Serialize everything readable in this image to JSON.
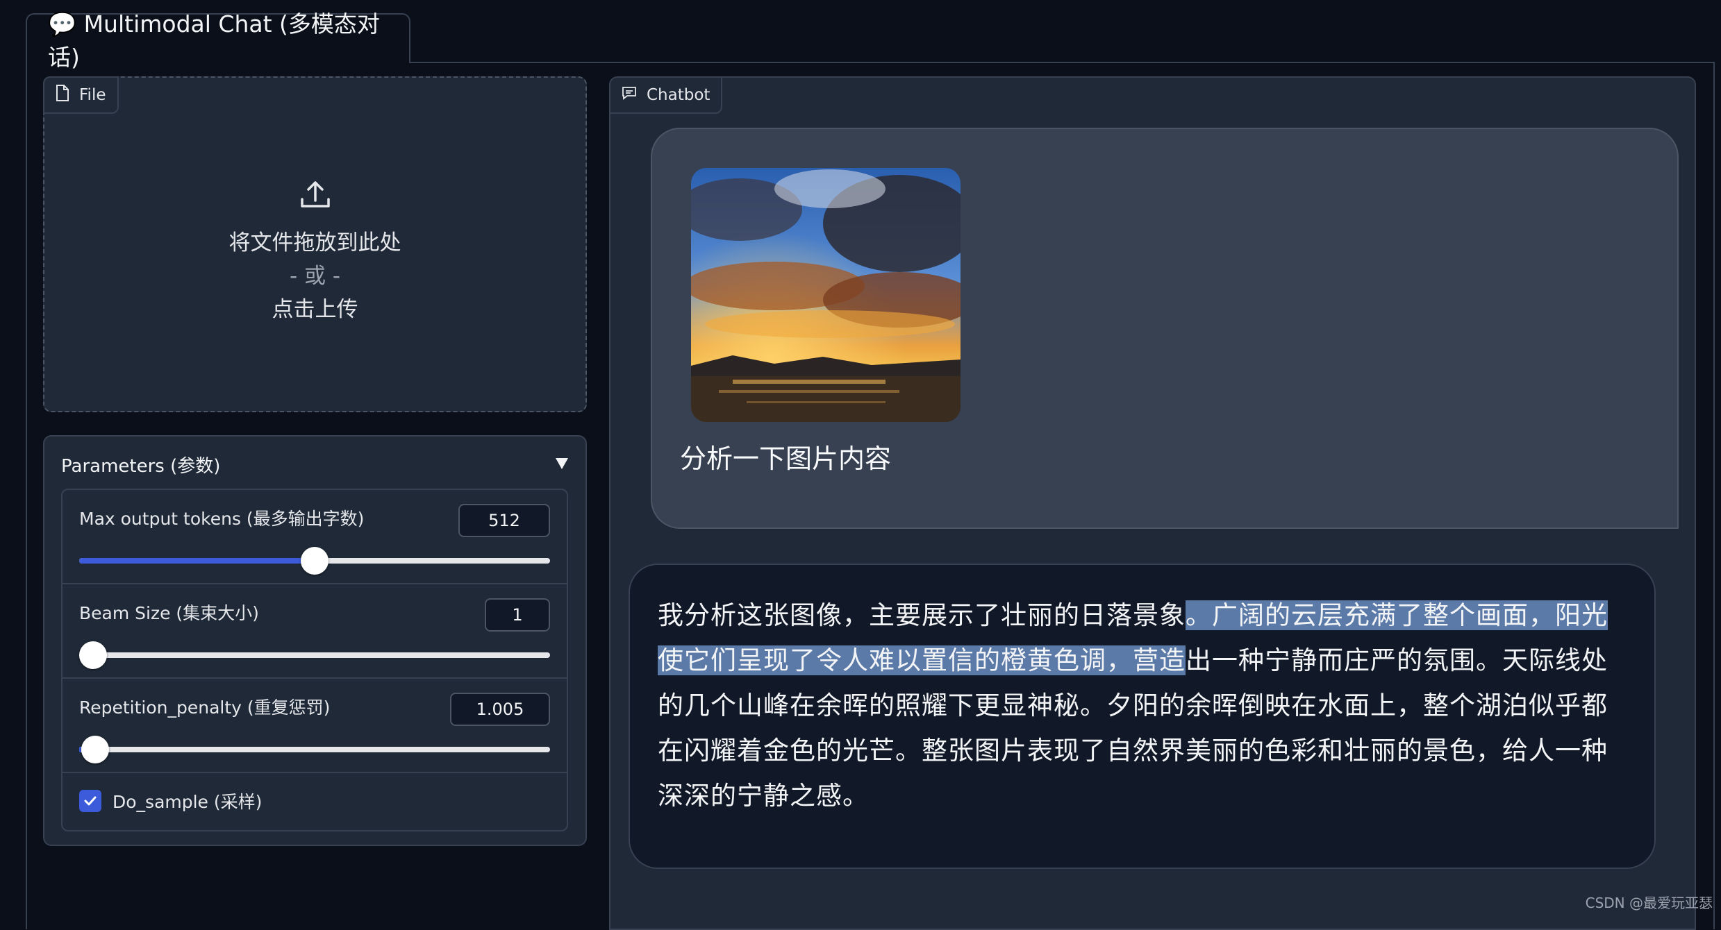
{
  "tab": {
    "label": "💬 Multimodal Chat (多模态对话)"
  },
  "file": {
    "label": "File",
    "drop_text": "将文件拖放到此处",
    "or_text": "- 或 -",
    "click_text": "点击上传"
  },
  "params": {
    "title": "Parameters (参数)",
    "max_tokens": {
      "label": "Max output tokens (最多输出字数)",
      "value": "512",
      "fraction": 0.5
    },
    "beam": {
      "label": "Beam Size (集束大小)",
      "value": "1",
      "fraction": 0.0
    },
    "rep": {
      "label": "Repetition_penalty (重复惩罚)",
      "value": "1.005",
      "fraction": 0.005
    },
    "sample": {
      "label": "Do_sample (采样)",
      "checked": true
    }
  },
  "chatbot": {
    "label": "Chatbot",
    "user_message": "分析一下图片内容",
    "bot_part1": "我分析这张图像，主要展示了壮丽的日落景象",
    "bot_selected": "。广阔的云层充满了整个画面，阳光使它们呈现了令人难以置信的橙黄色调，营造",
    "bot_part2": "出一种宁静而庄严的氛围。天际线处的几个山峰在余晖的照耀下更显神秘。夕阳的余晖倒映在水面上，整个湖泊似乎都在闪耀着金色的光芒。整张图片表现了自然界美丽的色彩和壮丽的景色，给人一种深深的宁静之感。"
  },
  "watermark": "CSDN @最爱玩亚瑟",
  "colors": {
    "accent": "#3b5bdb",
    "background": "#0b0f19",
    "panel": "#1f2937",
    "selection": "#5b7aa8"
  }
}
